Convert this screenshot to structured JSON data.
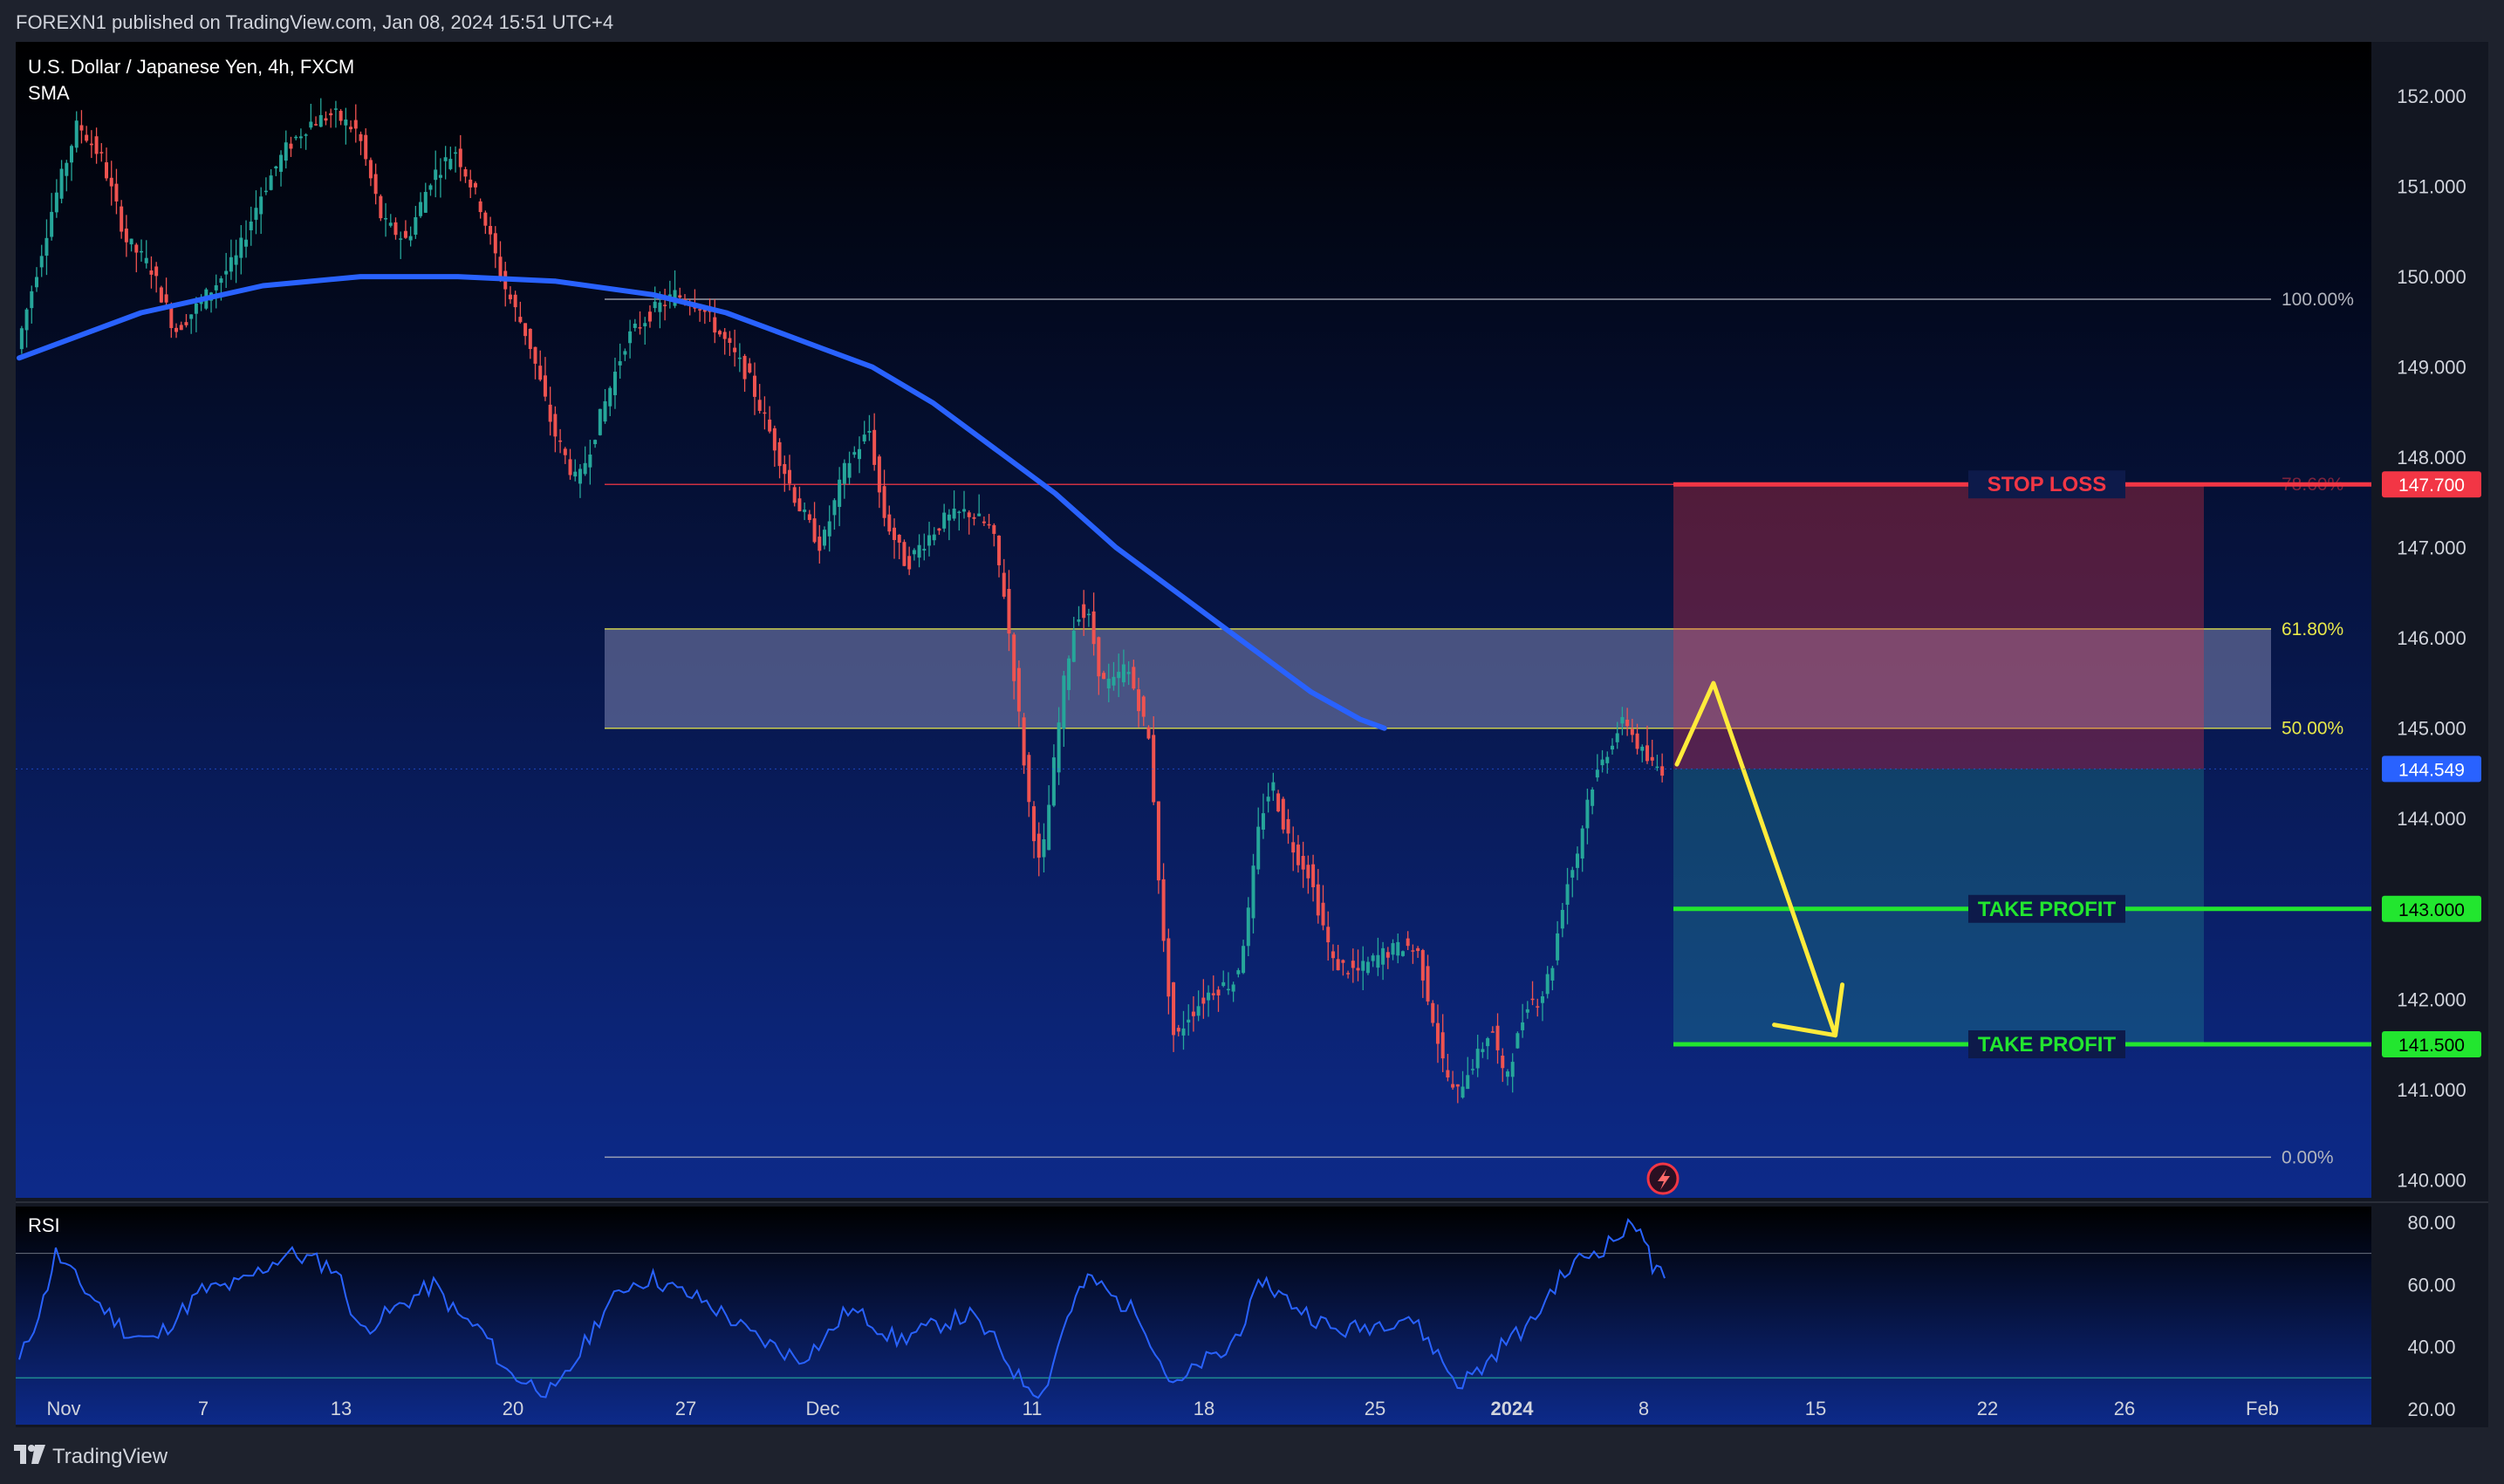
{
  "header": {
    "published_text": "FOREXN1 published on TradingView.com, Jan 08, 2024 15:51 UTC+4"
  },
  "legend": {
    "symbol_line": "U.S. Dollar / Japanese Yen, 4h, FXCM",
    "indicator_line": "SMA",
    "rsi_label": "RSI"
  },
  "footer": {
    "brand": "TradingView",
    "logo_icon": "tradingview-logo-icon"
  },
  "colors": {
    "bullish": "#26a69a",
    "bearish": "#ef5350",
    "sma": "#2962ff",
    "stop_loss": "#f23645",
    "take_profit": "#22e62f",
    "arrow": "#ffeb3b",
    "rsi_line": "#2962ff"
  },
  "chart_data": {
    "type": "candlestick",
    "title": "U.S. Dollar / Japanese Yen, 4h, FXCM",
    "price_axis_ticks": [
      "152.000",
      "151.000",
      "150.000",
      "149.000",
      "148.000",
      "147.000",
      "146.000",
      "145.000",
      "144.000",
      "142.000",
      "141.000",
      "140.000"
    ],
    "ylim": [
      139.8,
      152.6
    ],
    "time_axis_ticks": [
      "Nov",
      "7",
      "13",
      "20",
      "27",
      "Dec",
      "11",
      "18",
      "25",
      "2024",
      "8",
      "15",
      "22",
      "26",
      "Feb"
    ],
    "price_path": [
      [
        0,
        149.2
      ],
      [
        3,
        150.8
      ],
      [
        5,
        151.7
      ],
      [
        7,
        151.3
      ],
      [
        9,
        150.4
      ],
      [
        11,
        150.1
      ],
      [
        13,
        149.4
      ],
      [
        15,
        149.7
      ],
      [
        18,
        150.2
      ],
      [
        20,
        150.9
      ],
      [
        22,
        151.4
      ],
      [
        24,
        151.7
      ],
      [
        26,
        151.8
      ],
      [
        28,
        151.6
      ],
      [
        30,
        150.6
      ],
      [
        32,
        150.4
      ],
      [
        34,
        151.1
      ],
      [
        36,
        151.4
      ],
      [
        38,
        150.8
      ],
      [
        40,
        149.9
      ],
      [
        42,
        149.3
      ],
      [
        44,
        148.3
      ],
      [
        46,
        147.7
      ],
      [
        48,
        148.5
      ],
      [
        50,
        149.3
      ],
      [
        52,
        149.6
      ],
      [
        54,
        149.8
      ],
      [
        56,
        149.7
      ],
      [
        58,
        149.3
      ],
      [
        60,
        148.9
      ],
      [
        62,
        148.2
      ],
      [
        64,
        147.5
      ],
      [
        66,
        147.0
      ],
      [
        68,
        147.9
      ],
      [
        70,
        148.3
      ],
      [
        71,
        147.4
      ],
      [
        73,
        146.8
      ],
      [
        74,
        147.0
      ],
      [
        76,
        147.3
      ],
      [
        78,
        147.4
      ],
      [
        80,
        147.2
      ],
      [
        81,
        146.5
      ],
      [
        82,
        145.4
      ],
      [
        83,
        144.2
      ],
      [
        84,
        143.4
      ],
      [
        85,
        144.5
      ],
      [
        86,
        145.6
      ],
      [
        87,
        146.3
      ],
      [
        88,
        146.2
      ],
      [
        89,
        145.5
      ],
      [
        90,
        145.5
      ],
      [
        91,
        145.7
      ],
      [
        92,
        145.3
      ],
      [
        93,
        144.8
      ],
      [
        94,
        142.7
      ],
      [
        95,
        141.5
      ],
      [
        96,
        141.8
      ],
      [
        98,
        142.1
      ],
      [
        100,
        142.2
      ],
      [
        101,
        142.9
      ],
      [
        102,
        144.0
      ],
      [
        103,
        144.4
      ],
      [
        104,
        143.9
      ],
      [
        105,
        143.6
      ],
      [
        106,
        143.4
      ],
      [
        107,
        142.9
      ],
      [
        108,
        142.4
      ],
      [
        110,
        142.3
      ],
      [
        112,
        142.5
      ],
      [
        114,
        142.6
      ],
      [
        115,
        142.5
      ],
      [
        116,
        141.9
      ],
      [
        117,
        141.3
      ],
      [
        118,
        140.9
      ],
      [
        119,
        141.2
      ],
      [
        120,
        141.4
      ],
      [
        121,
        141.7
      ],
      [
        122,
        141.1
      ],
      [
        123,
        141.5
      ],
      [
        124,
        142.0
      ],
      [
        125,
        142.0
      ],
      [
        126,
        142.4
      ],
      [
        127,
        143.2
      ],
      [
        128,
        143.6
      ],
      [
        129,
        144.3
      ],
      [
        130,
        144.6
      ],
      [
        131,
        144.9
      ],
      [
        132,
        145.1
      ],
      [
        133,
        144.8
      ],
      [
        134,
        144.6
      ],
      [
        135,
        144.549
      ]
    ],
    "series": [
      {
        "name": "SMA",
        "points": [
          [
            0,
            149.1
          ],
          [
            10,
            149.6
          ],
          [
            20,
            149.9
          ],
          [
            28,
            150.0
          ],
          [
            36,
            150.0
          ],
          [
            44,
            149.95
          ],
          [
            52,
            149.8
          ],
          [
            58,
            149.6
          ],
          [
            62,
            149.4
          ],
          [
            66,
            149.2
          ],
          [
            70,
            149.0
          ],
          [
            75,
            148.6
          ],
          [
            80,
            148.1
          ],
          [
            85,
            147.6
          ],
          [
            90,
            147.0
          ],
          [
            95,
            146.5
          ],
          [
            100,
            146.0
          ],
          [
            104,
            145.6
          ],
          [
            106,
            145.4
          ],
          [
            108,
            145.25
          ],
          [
            110,
            145.1
          ],
          [
            112,
            145.0
          ]
        ],
        "label_visible": false
      }
    ],
    "last_price": "144.549",
    "fibonacci": {
      "levels": [
        {
          "ratio": "100.00%",
          "price": 149.75
        },
        {
          "ratio": "78.60%",
          "price": 147.7
        },
        {
          "ratio": "61.80%",
          "price": 146.1
        },
        {
          "ratio": "50.00%",
          "price": 145.0
        },
        {
          "ratio": "0.00%",
          "price": 140.25
        }
      ],
      "zone_between": [
        "61.80%",
        "50.00%"
      ]
    },
    "trade_plan": {
      "stop_loss": {
        "label": "STOP LOSS",
        "price": 147.7,
        "price_label": "147.700"
      },
      "take_profit_1": {
        "label": "TAKE PROFIT",
        "price": 143.0,
        "price_label": "143.000"
      },
      "take_profit_2": {
        "label": "TAKE PROFIT",
        "price": 141.5,
        "price_label": "141.500"
      },
      "projected_path": [
        [
          136,
          144.6
        ],
        [
          139,
          145.5
        ],
        [
          149,
          141.6
        ]
      ],
      "arrow_end": [
        148,
        141.5
      ]
    },
    "rsi": {
      "ticks": [
        "80.00",
        "60.00",
        "40.00",
        "20.00"
      ],
      "upper_band": 70,
      "lower_band": 30,
      "ylim": [
        15,
        85
      ],
      "values": [
        [
          0,
          35
        ],
        [
          2,
          55
        ],
        [
          3,
          70
        ],
        [
          5,
          60
        ],
        [
          7,
          52
        ],
        [
          9,
          44
        ],
        [
          11,
          42
        ],
        [
          13,
          50
        ],
        [
          15,
          58
        ],
        [
          18,
          60
        ],
        [
          20,
          65
        ],
        [
          22,
          70
        ],
        [
          24,
          68
        ],
        [
          26,
          65
        ],
        [
          28,
          45
        ],
        [
          30,
          50
        ],
        [
          32,
          55
        ],
        [
          34,
          60
        ],
        [
          36,
          50
        ],
        [
          38,
          45
        ],
        [
          40,
          32
        ],
        [
          42,
          28
        ],
        [
          44,
          25
        ],
        [
          46,
          38
        ],
        [
          48,
          52
        ],
        [
          50,
          60
        ],
        [
          52,
          62
        ],
        [
          54,
          58
        ],
        [
          56,
          55
        ],
        [
          58,
          50
        ],
        [
          60,
          44
        ],
        [
          62,
          40
        ],
        [
          64,
          36
        ],
        [
          66,
          42
        ],
        [
          68,
          52
        ],
        [
          70,
          48
        ],
        [
          72,
          42
        ],
        [
          74,
          45
        ],
        [
          76,
          48
        ],
        [
          78,
          50
        ],
        [
          80,
          42
        ],
        [
          82,
          30
        ],
        [
          84,
          25
        ],
        [
          86,
          50
        ],
        [
          87,
          58
        ],
        [
          88,
          62
        ],
        [
          90,
          55
        ],
        [
          92,
          50
        ],
        [
          94,
          32
        ],
        [
          95,
          27
        ],
        [
          97,
          35
        ],
        [
          99,
          38
        ],
        [
          101,
          52
        ],
        [
          102,
          62
        ],
        [
          103,
          58
        ],
        [
          104,
          55
        ],
        [
          106,
          50
        ],
        [
          108,
          45
        ],
        [
          110,
          46
        ],
        [
          112,
          48
        ],
        [
          114,
          50
        ],
        [
          116,
          40
        ],
        [
          118,
          28
        ],
        [
          120,
          33
        ],
        [
          122,
          42
        ],
        [
          124,
          47
        ],
        [
          126,
          60
        ],
        [
          128,
          68
        ],
        [
          130,
          72
        ],
        [
          132,
          78
        ],
        [
          133,
          80
        ],
        [
          134,
          65
        ],
        [
          135,
          62
        ]
      ]
    }
  }
}
